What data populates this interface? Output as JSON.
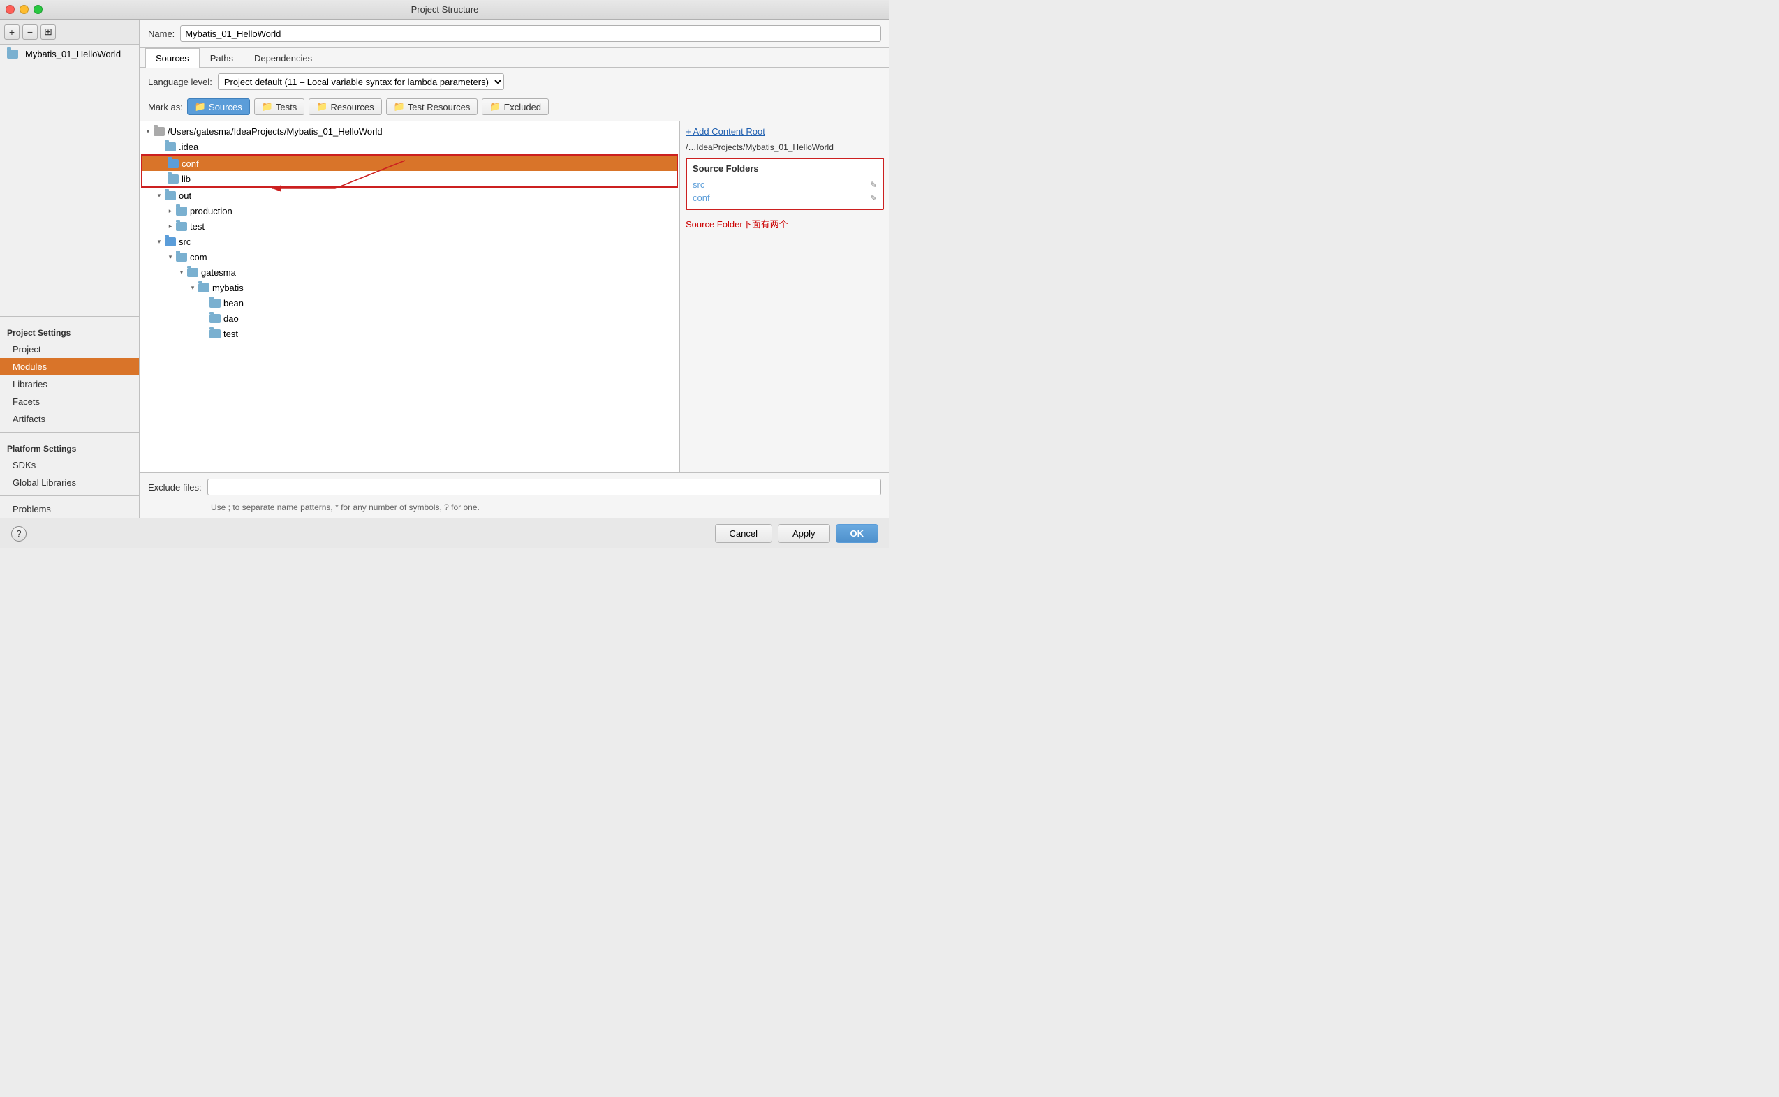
{
  "window": {
    "title": "Project Structure"
  },
  "sidebar": {
    "project_settings_title": "Project Settings",
    "items": [
      {
        "id": "project",
        "label": "Project",
        "active": false
      },
      {
        "id": "modules",
        "label": "Modules",
        "active": true
      },
      {
        "id": "libraries",
        "label": "Libraries",
        "active": false
      },
      {
        "id": "facets",
        "label": "Facets",
        "active": false
      },
      {
        "id": "artifacts",
        "label": "Artifacts",
        "active": false
      }
    ],
    "platform_settings_title": "Platform Settings",
    "platform_items": [
      {
        "id": "sdks",
        "label": "SDKs"
      },
      {
        "id": "global-libraries",
        "label": "Global Libraries"
      }
    ],
    "problems_label": "Problems",
    "module_name": "Mybatis_01_HelloWorld"
  },
  "content": {
    "name_label": "Name:",
    "name_value": "Mybatis_01_HelloWorld",
    "tabs": [
      {
        "id": "sources",
        "label": "Sources",
        "active": true
      },
      {
        "id": "paths",
        "label": "Paths",
        "active": false
      },
      {
        "id": "dependencies",
        "label": "Dependencies",
        "active": false
      }
    ],
    "lang_level_label": "Language level:",
    "lang_level_value": "Project default (11 – Local variable syntax for lambda parameters)",
    "mark_as_label": "Mark as:",
    "mark_btns": [
      {
        "id": "sources-btn",
        "label": "Sources",
        "type": "sources"
      },
      {
        "id": "tests-btn",
        "label": "Tests",
        "type": "tests"
      },
      {
        "id": "resources-btn",
        "label": "Resources",
        "type": "resources"
      },
      {
        "id": "test-resources-btn",
        "label": "Test Resources",
        "type": "testresources"
      },
      {
        "id": "excluded-btn",
        "label": "Excluded",
        "type": "excluded"
      }
    ],
    "tree": {
      "root_path": "/Users/gatesma/IdeaProjects/Mybatis_01_HelloWorld",
      "items": [
        {
          "id": "root",
          "label": "/Users/gatesma/IdeaProjects/Mybatis_01_HelloWorld",
          "type": "root",
          "indent": 0,
          "chevron": "open"
        },
        {
          "id": "idea",
          "label": ".idea",
          "type": "folder-blue",
          "indent": 1,
          "chevron": "empty"
        },
        {
          "id": "conf",
          "label": "conf",
          "type": "folder-source",
          "indent": 1,
          "chevron": "empty",
          "selected": true
        },
        {
          "id": "lib",
          "label": "lib",
          "type": "folder-blue",
          "indent": 1,
          "chevron": "empty"
        },
        {
          "id": "out",
          "label": "out",
          "type": "folder-blue",
          "indent": 1,
          "chevron": "open"
        },
        {
          "id": "production",
          "label": "production",
          "type": "folder-blue",
          "indent": 2,
          "chevron": "closed"
        },
        {
          "id": "test-out",
          "label": "test",
          "type": "folder-blue",
          "indent": 2,
          "chevron": "closed"
        },
        {
          "id": "src",
          "label": "src",
          "type": "folder-source",
          "indent": 1,
          "chevron": "open"
        },
        {
          "id": "com",
          "label": "com",
          "type": "folder-blue",
          "indent": 2,
          "chevron": "open"
        },
        {
          "id": "gatesma",
          "label": "gatesma",
          "type": "folder-blue",
          "indent": 3,
          "chevron": "open"
        },
        {
          "id": "mybatis",
          "label": "mybatis",
          "type": "folder-blue",
          "indent": 4,
          "chevron": "open"
        },
        {
          "id": "bean",
          "label": "bean",
          "type": "folder-blue",
          "indent": 5,
          "chevron": "empty"
        },
        {
          "id": "dao",
          "label": "dao",
          "type": "folder-blue",
          "indent": 5,
          "chevron": "empty"
        },
        {
          "id": "test-src",
          "label": "test",
          "type": "folder-blue",
          "indent": 5,
          "chevron": "empty"
        }
      ]
    },
    "exclude_files_label": "Exclude files:",
    "exclude_hint": "Use ; to separate name patterns, * for any number of symbols, ? for one.",
    "right_panel": {
      "add_content_root": "+ Add Content Root",
      "content_root_path": "/…IdeaProjects/Mybatis_01_HelloWorld",
      "source_folders_title": "Source Folders",
      "source_folders": [
        {
          "name": "src"
        },
        {
          "name": "conf"
        }
      ],
      "annotation": "Source Folder下面有两个"
    }
  },
  "bottom": {
    "help_label": "?",
    "cancel_label": "Cancel",
    "apply_label": "Apply",
    "ok_label": "OK"
  }
}
